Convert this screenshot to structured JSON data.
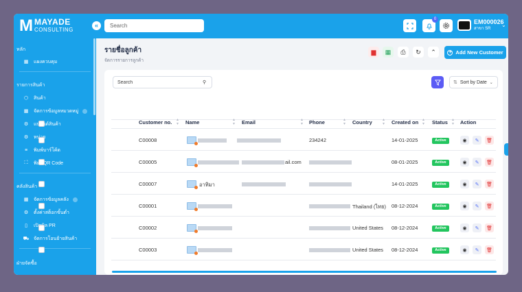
{
  "header": {
    "logo_main": "MAYADE",
    "logo_sub": "CONSULTING",
    "collapse_icon": "«",
    "search_placeholder": "Search",
    "notification_count": "0",
    "user_id": "EM000026",
    "user_branch": "สาขา SR"
  },
  "sidebar": {
    "sections": [
      {
        "label": "หลัก"
      },
      {
        "label": "รายการสินค้า"
      },
      {
        "label": "คลังสินค้า"
      },
      {
        "label": "ฝ่ายจัดซื้อ"
      }
    ],
    "items": [
      {
        "label": "แผงควบคุม",
        "icon": "grid-icon"
      },
      {
        "label": "สินค้า",
        "icon": "box-icon"
      },
      {
        "label": "จัดการข้อมูลหมวดหมู่",
        "icon": "grid-icon"
      },
      {
        "label": "แบรนด์สินค้า",
        "icon": "settings-icon"
      },
      {
        "label": "หน่วย",
        "icon": "settings-icon"
      },
      {
        "label": "พิมพ์บาร์โค้ด",
        "icon": "barcode-icon"
      },
      {
        "label": "พิมพ์QR Code",
        "icon": "qr-icon"
      },
      {
        "label": "จัดการข้อมูลคลัง",
        "icon": "grid-icon"
      },
      {
        "label": "ตั้งค่าสต็อกขั้นต่ำ",
        "icon": "settings-icon"
      },
      {
        "label": "เปิดบิล PR",
        "icon": "clipboard-icon"
      },
      {
        "label": "จัดการโอนย้ายสินค้า",
        "icon": "truck-icon"
      }
    ]
  },
  "page": {
    "title": "รายชื่อลูกค้า",
    "subtitle": "จัดการรายการลูกค้า",
    "add_button": "Add New Customer"
  },
  "toolbar": {
    "search_placeholder": "Search",
    "sort_label": "Sort by Date"
  },
  "table": {
    "columns": [
      "Customer no.",
      "Name",
      "Email",
      "Phone",
      "Country",
      "Created on",
      "Status",
      "Action"
    ],
    "rows": [
      {
        "customer_no": "C00008",
        "name": "",
        "email": "",
        "phone": "234242",
        "country": "",
        "created_on": "14-01-2025",
        "status": "Active"
      },
      {
        "customer_no": "C00005",
        "name": "",
        "email": "ail.com",
        "phone": "",
        "country": "",
        "created_on": "08-01-2025",
        "status": "Active"
      },
      {
        "customer_no": "C00007",
        "name": "อาทิมา",
        "email": "",
        "phone": "",
        "country": "",
        "created_on": "14-01-2025",
        "status": "Active"
      },
      {
        "customer_no": "C00001",
        "name": "",
        "email": "",
        "phone": "",
        "country": "Thailand (ไทย)",
        "created_on": "08-12-2024",
        "status": "Active"
      },
      {
        "customer_no": "C00002",
        "name": "",
        "email": "",
        "phone": "",
        "country": "United States",
        "created_on": "08-12-2024",
        "status": "Active"
      },
      {
        "customer_no": "C00003",
        "name": "",
        "email": "",
        "phone": "",
        "country": "United States",
        "created_on": "08-12-2024",
        "status": "Active"
      }
    ]
  },
  "colors": {
    "primary": "#1aa2ea",
    "active": "#22c55e",
    "filter": "#5b5bf5",
    "danger": "#e03131"
  }
}
